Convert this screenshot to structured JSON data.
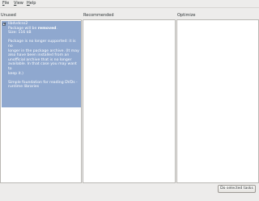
{
  "menubar": {
    "items": [
      {
        "label": "File",
        "mnemonic": "F",
        "rest": "ile"
      },
      {
        "label": "View",
        "mnemonic": "V",
        "rest": "iew"
      },
      {
        "label": "Help",
        "mnemonic": "H",
        "rest": "elp"
      }
    ]
  },
  "columns": {
    "unused": "Unused",
    "recommended": "Recommended",
    "optimize": "Optimize"
  },
  "unused_item": {
    "checked": true,
    "name": "libdvdcss2",
    "status_prefix": "Package will be ",
    "status_bold": "removed",
    "status_suffix": ".",
    "size": "Size: 116 kB",
    "desc_lines": [
      "Package is no longer supported: it is no",
      "longer in the package archive. (It may",
      "also have been installed from an",
      "unofficial archive that is no longer",
      "available. In that case you may want to",
      "keep it.)"
    ],
    "summary_lines": [
      "Simple foundation for reading DVDs -",
      "runtime libraries"
    ]
  },
  "actions": {
    "do_selected": "Do selected tasks"
  }
}
